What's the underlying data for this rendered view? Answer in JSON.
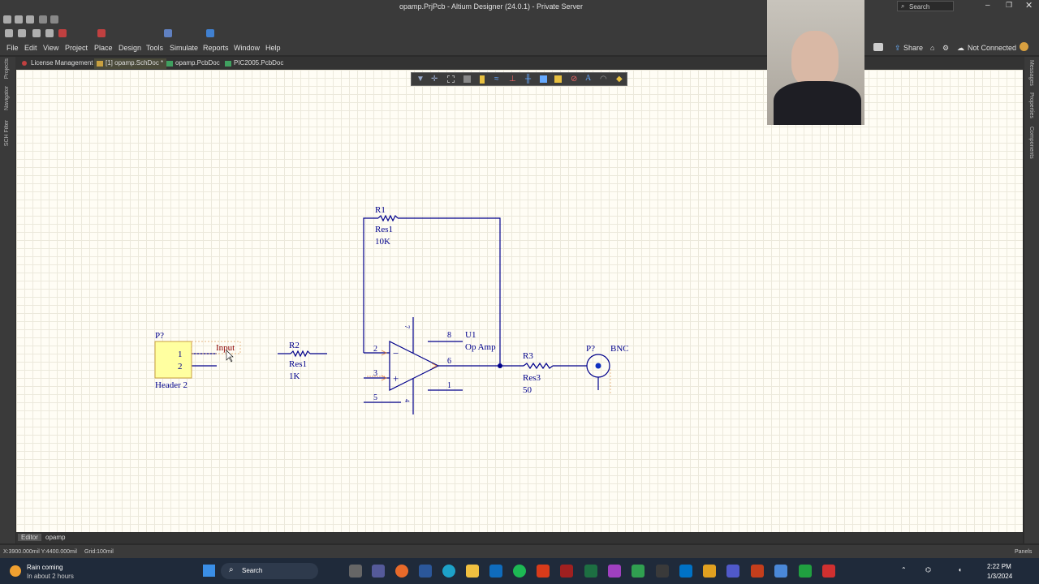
{
  "window": {
    "title": "opamp.PrjPcb - Altium Designer (24.0.1) - Private Server",
    "search_label": "Search"
  },
  "menu": {
    "items": [
      "File",
      "Edit",
      "View",
      "Project",
      "Place",
      "Design",
      "Tools",
      "Simulate",
      "Reports",
      "Window",
      "Help"
    ],
    "share": "Share",
    "connection": "Not Connected"
  },
  "tabs": [
    {
      "label": "License Management"
    },
    {
      "label": "[1] opamp.SchDoc *"
    },
    {
      "label": "opamp.PcbDoc"
    },
    {
      "label": "PIC2005.PcbDoc"
    }
  ],
  "left_panels": [
    "Projects",
    "Navigator",
    "SCH Filter"
  ],
  "right_panels": [
    "Messages",
    "Properties",
    "Components"
  ],
  "schematic": {
    "r1": {
      "designator": "R1",
      "comment": "Res1",
      "value": "10K"
    },
    "r2": {
      "designator": "R2",
      "comment": "Res1",
      "value": "1K"
    },
    "r3": {
      "designator": "R3",
      "comment": "Res3",
      "value": "50"
    },
    "u1": {
      "designator": "U1",
      "comment": "Op Amp",
      "pins": [
        "2",
        "3",
        "5",
        "8",
        "6",
        "1",
        "7",
        "4"
      ]
    },
    "header": {
      "designator": "P?",
      "comment": "Header 2",
      "pins": [
        "1",
        "2"
      ]
    },
    "bnc": {
      "designator": "P?",
      "comment": "BNC"
    },
    "net_label": "Input"
  },
  "bottom_tabs": [
    "Editor",
    "opamp"
  ],
  "status": {
    "coords": "X:3900.000mil Y:4400.000mil",
    "grid": "Grid:100mil",
    "panels": "Panels"
  },
  "taskbar": {
    "weather_title": "Rain coming",
    "weather_sub": "In about 2 hours",
    "search": "Search",
    "time": "2:22 PM",
    "date": "1/3/2024"
  },
  "colors": {
    "wire": "#00008b",
    "text": "#00008b",
    "net_label": "#8b0000",
    "header_fill": "#ffffa0",
    "canvas": "#fffdf5"
  }
}
